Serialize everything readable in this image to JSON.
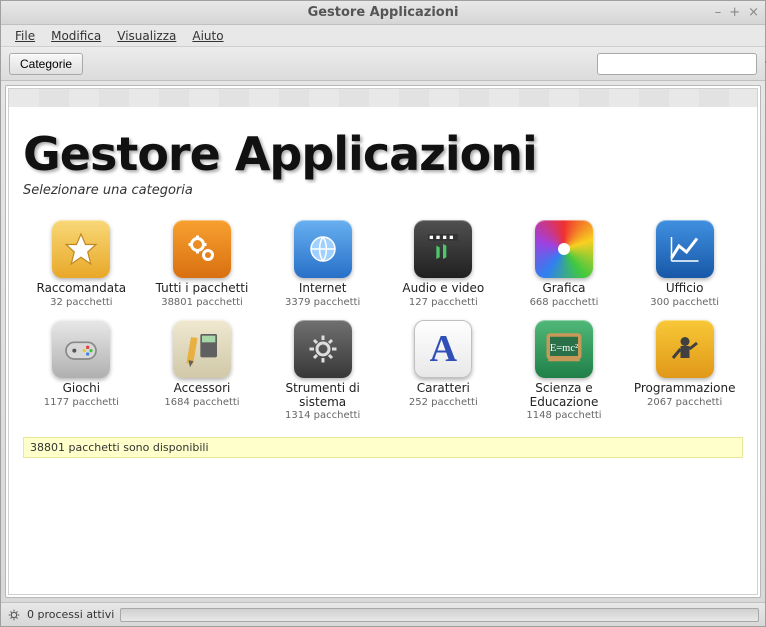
{
  "window": {
    "title": "Gestore Applicazioni"
  },
  "menu": {
    "file": "File",
    "edit": "Modifica",
    "view": "Visualizza",
    "help": "Aiuto"
  },
  "toolbar": {
    "categories": "Categorie",
    "search_placeholder": ""
  },
  "main": {
    "heading": "Gestore Applicazioni",
    "subtitle": "Selezionare una categoria"
  },
  "categories": [
    {
      "id": "recommended",
      "label": "Raccomandata",
      "count": "32 pacchetti"
    },
    {
      "id": "all",
      "label": "Tutti i pacchetti",
      "count": "38801 pacchetti"
    },
    {
      "id": "internet",
      "label": "Internet",
      "count": "3379 pacchetti"
    },
    {
      "id": "audiovideo",
      "label": "Audio e video",
      "count": "127 pacchetti"
    },
    {
      "id": "graphics",
      "label": "Grafica",
      "count": "668 pacchetti"
    },
    {
      "id": "office",
      "label": "Ufficio",
      "count": "300 pacchetti"
    },
    {
      "id": "games",
      "label": "Giochi",
      "count": "1177 pacchetti"
    },
    {
      "id": "accessories",
      "label": "Accessori",
      "count": "1684 pacchetti"
    },
    {
      "id": "systemtools",
      "label": "Strumenti di sistema",
      "count": "1314 pacchetti"
    },
    {
      "id": "fonts",
      "label": "Caratteri",
      "count": "252 pacchetti"
    },
    {
      "id": "science",
      "label": "Scienza e Educazione",
      "count": "1148 pacchetti"
    },
    {
      "id": "programming",
      "label": "Programmazione",
      "count": "2067 pacchetti"
    }
  ],
  "status_strip": "38801 pacchetti sono disponibili",
  "statusbar": {
    "processes": "0 processi attivi"
  }
}
